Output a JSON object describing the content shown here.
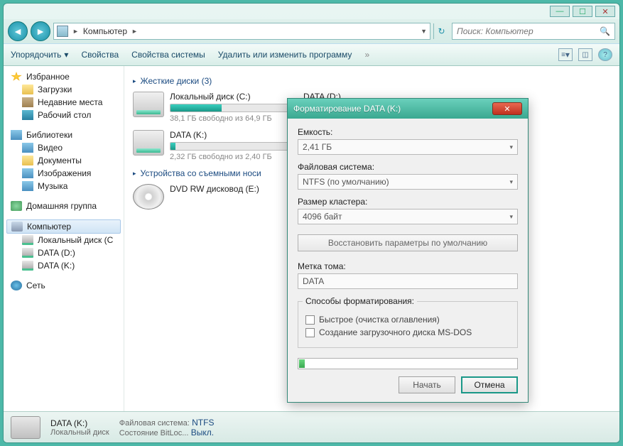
{
  "titlebar": {
    "min": "—",
    "max": "☐",
    "close": "✕"
  },
  "nav": {
    "back": "◄",
    "fwd": "►",
    "breadcrumb": "Компьютер",
    "sep": "►",
    "refresh": "↻",
    "search_placeholder": "Поиск: Компьютер",
    "search_icon": "🔍"
  },
  "toolbar": {
    "organize": "Упорядочить",
    "props": "Свойства",
    "sysprops": "Свойства системы",
    "uninstall": "Удалить или изменить программу",
    "more": "»",
    "dd_arrow": "▾",
    "help": "?"
  },
  "sidebar": {
    "favorites": "Избранное",
    "downloads": "Загрузки",
    "recent": "Недавние места",
    "desktop": "Рабочий стол",
    "libraries": "Библиотеки",
    "video": "Видео",
    "documents": "Документы",
    "pictures": "Изображения",
    "music": "Музыка",
    "homegroup": "Домашняя группа",
    "computer": "Компьютер",
    "local_c": "Локальный диск (C",
    "data_d": "DATA (D:)",
    "data_k": "DATA (K:)",
    "network": "Сеть"
  },
  "content": {
    "hdd_header": "Жесткие диски (3)",
    "removable_header": "Устройства со съемными носи",
    "tri": "▸",
    "drives": [
      {
        "name": "Локальный диск (C:)",
        "sub": "38,1 ГБ свободно из 64,9 ГБ",
        "fill": 41
      },
      {
        "name": "DATA (D:)",
        "sub": "",
        "fill": 0
      },
      {
        "name": "DATA (K:)",
        "sub": "2,32 ГБ свободно из 2,40 ГБ",
        "fill": 4
      }
    ],
    "dvd": "DVD RW дисковод (E:)"
  },
  "statusbar": {
    "title": "DATA (K:)",
    "sub": "Локальный диск",
    "fs_label": "Файловая система:",
    "fs_val": "NTFS",
    "bl_label": "Состояние BitLoc...",
    "bl_val": "Выкл."
  },
  "dialog": {
    "title": "Форматирование DATA (K:)",
    "close": "✕",
    "capacity_label": "Емкость:",
    "capacity_val": "2,41 ГБ",
    "fs_label": "Файловая система:",
    "fs_val": "NTFS (по умолчанию)",
    "cluster_label": "Размер кластера:",
    "cluster_val": "4096 байт",
    "restore": "Восстановить параметры по умолчанию",
    "volume_label": "Метка тома:",
    "volume_val": "DATA",
    "methods_legend": "Способы форматирования:",
    "quick": "Быстрое (очистка оглавления)",
    "msdos": "Создание загрузочного диска MS-DOS",
    "start": "Начать",
    "cancel": "Отмена",
    "dd": "▾"
  }
}
